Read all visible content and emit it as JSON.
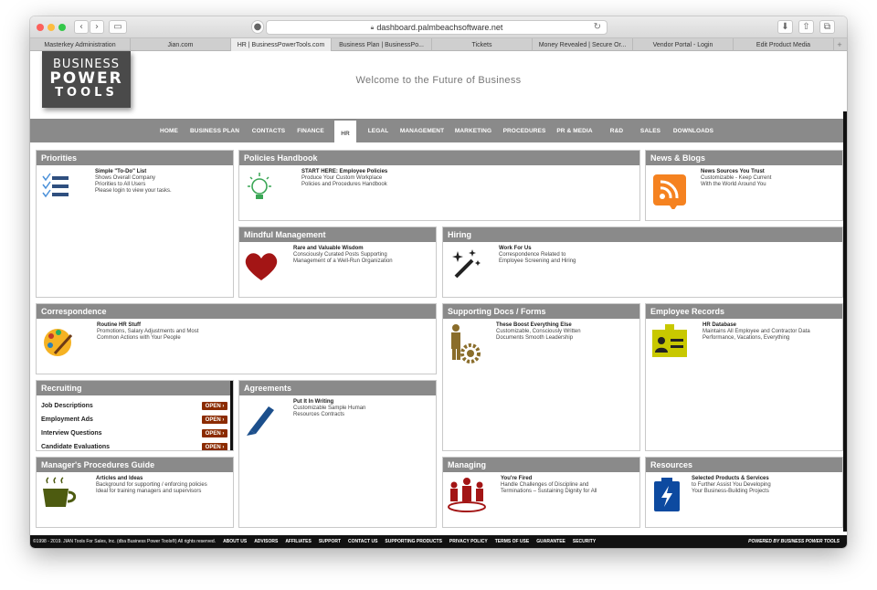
{
  "browser": {
    "url": "dashboard.palmbeachsoftware.net",
    "tabs": [
      {
        "label": "Masterkey Administration"
      },
      {
        "label": "Jian.com"
      },
      {
        "label": "HR | BusinessPowerTools.com"
      },
      {
        "label": "Business Plan | BusinessPo..."
      },
      {
        "label": "Tickets"
      },
      {
        "label": "Money Revealed | Secure Or..."
      },
      {
        "label": "Vendor Portal - Login"
      },
      {
        "label": "Edit Product Media"
      }
    ],
    "new_tab": "+"
  },
  "header": {
    "logo": {
      "line1": "BUSINESS",
      "line2": "POWER",
      "line3": "TOOLS"
    },
    "welcome": "Welcome to the Future of Business"
  },
  "nav": {
    "items": [
      "HOME",
      "BUSINESS PLAN",
      "CONTACTS",
      "FINANCE",
      "HR",
      "LEGAL",
      "MANAGEMENT",
      "MARKETING",
      "PROCEDURES",
      "PR & MEDIA",
      "R&D",
      "SALES",
      "DOWNLOADS"
    ],
    "active": "HR"
  },
  "panels": {
    "priorities": {
      "title": "Priorities",
      "heading": "Simple \"To-Do\" List",
      "lines": [
        "Shows Overall Company",
        "Priorities to All Users",
        "Please login to view your tasks."
      ]
    },
    "policies": {
      "title": "Policies Handbook",
      "heading": "START HERE: Employee Policies",
      "lines": [
        "Produce Your Custom Workplace",
        "Policies and Procedures Handbook"
      ]
    },
    "news": {
      "title": "News & Blogs",
      "heading": "News Sources You Trust",
      "lines": [
        "Customizable - Keep Current",
        "With the World Around You"
      ]
    },
    "mindful": {
      "title": "Mindful Management",
      "heading": "Rare and Valuable Wisdom",
      "lines": [
        "Consciously Curated Posts Supporting",
        "Management of a Well-Run Organization"
      ]
    },
    "hiring": {
      "title": "Hiring",
      "heading": "Work For Us",
      "lines": [
        "Correspondence Related to",
        "Employee Screening and Hiring"
      ]
    },
    "correspondence": {
      "title": "Correspondence",
      "heading": "Routine HR Stuff",
      "lines": [
        "Promotions, Salary Adjustments and Most",
        "Common Actions with Your People"
      ]
    },
    "supporting": {
      "title": "Supporting Docs / Forms",
      "heading": "These Boost Everything Else",
      "lines": [
        "Customizable, Consciously Written",
        "Documents Smooth Leadership"
      ]
    },
    "employee_records": {
      "title": "Employee Records",
      "heading": "HR Database",
      "lines": [
        "Maintains All Employee and Contractor Data",
        "Performance, Vacations, Everything"
      ]
    },
    "recruiting": {
      "title": "Recruiting",
      "open_label": "OPEN ›",
      "items": [
        "Job Descriptions",
        "Employment Ads",
        "Interview Questions",
        "Candidate Evaluations"
      ]
    },
    "agreements": {
      "title": "Agreements",
      "heading": "Put It In Writing",
      "lines": [
        "Customizable Sample Human",
        "Resources Contracts"
      ]
    },
    "managers_guide": {
      "title": "Manager's Procedures Guide",
      "heading": "Articles and Ideas",
      "lines": [
        "Background for supporting / enforcing policies",
        "Ideal for training managers and supervisors"
      ]
    },
    "managing": {
      "title": "Managing",
      "heading": "You're Fired",
      "lines": [
        "Handle Challenges of Discipline and",
        "Terminations – Sustaining Dignity for All"
      ]
    },
    "resources": {
      "title": "Resources",
      "heading": "Selected Products & Services",
      "lines": [
        "to Further Assist You Developing",
        "Your Business-Building Projects"
      ]
    }
  },
  "footer": {
    "copyright": "©1998 - 2019. JIAN Tools For Sales, Inc. (dba Business Power Tools®) All rights reserved.",
    "links": [
      "ABOUT US",
      "ADVISORS",
      "AFFILIATES",
      "SUPPORT",
      "CONTACT US",
      "SUPPORTING PRODUCTS",
      "PRIVACY POLICY",
      "TERMS OF USE",
      "GUARANTEE",
      "SECURITY"
    ],
    "powered": "POWERED BY BUSINESS POWER TOOLS"
  },
  "colors": {
    "panel_header": "#8a8a8a",
    "open_button": "#8b2b00",
    "nav_bar": "#8a8a8a"
  }
}
